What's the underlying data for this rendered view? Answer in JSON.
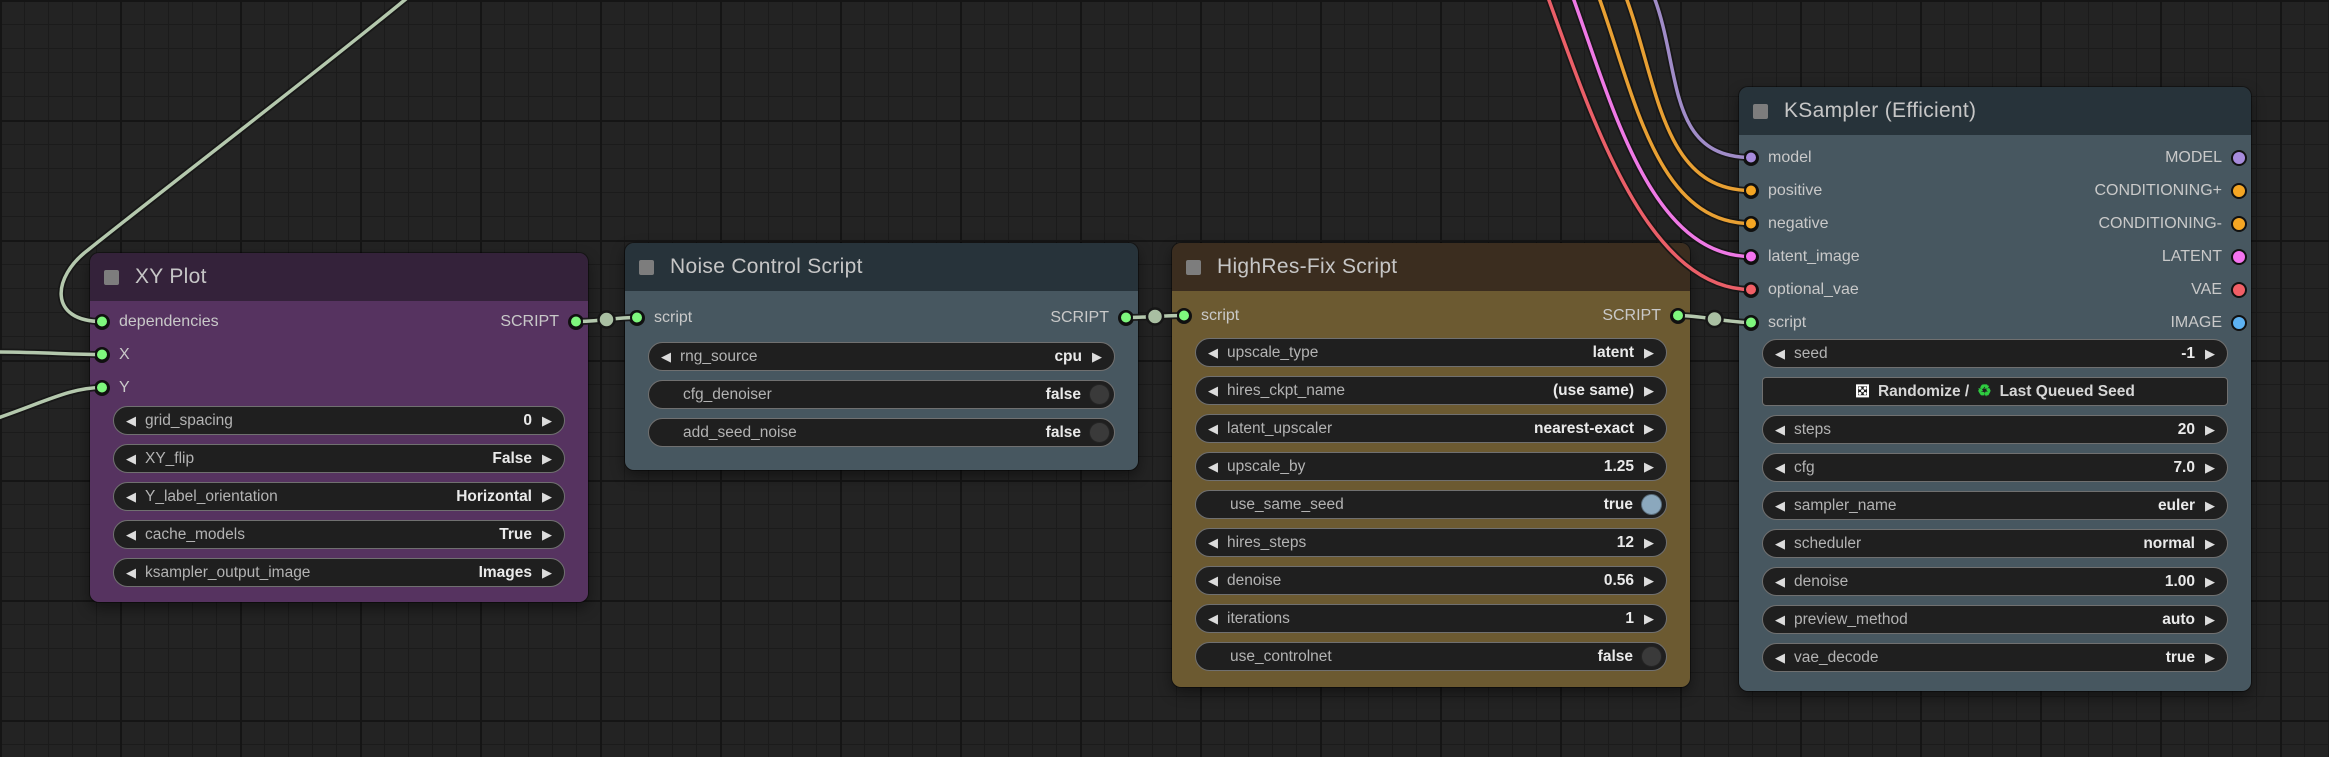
{
  "app": {
    "name": "node-graph-editor"
  },
  "palette": {
    "background": "#232323",
    "grid_minor": "#1b1b1b",
    "grid_major": "#151515",
    "link_dot": "#a9bfa2",
    "wire_green": "#b4c8ad",
    "wire_purple": "#a08cc8",
    "wire_orange": "#e8a033",
    "wire_pink": "#ef79e6",
    "wire_red": "#ea5f68",
    "toggle_on": "#8ba8bd",
    "toggle_off": "#3a3a3a",
    "widget_bg": "#1f1f1f",
    "widget_border": "#707070"
  },
  "glyphs": {
    "left_arrow": "◀",
    "right_arrow": "▶",
    "dice": "⚄",
    "recycle": "♻"
  },
  "nodes": [
    {
      "title": "XY Plot",
      "header_color": "#34223a",
      "body_color": "#563360",
      "inputs": [
        {
          "label": "dependencies",
          "color": "#7ef77d"
        },
        {
          "label": "X",
          "color": "#7ef77d"
        },
        {
          "label": "Y",
          "color": "#7ef77d"
        }
      ],
      "outputs": [
        {
          "label": "SCRIPT",
          "color": "#7ef77d"
        }
      ],
      "widgets": [
        {
          "type": "number",
          "label": "grid_spacing",
          "value": "0"
        },
        {
          "type": "combo",
          "label": "XY_flip",
          "value": "False"
        },
        {
          "type": "combo",
          "label": "Y_label_orientation",
          "value": "Horizontal"
        },
        {
          "type": "combo",
          "label": "cache_models",
          "value": "True"
        },
        {
          "type": "combo",
          "label": "ksampler_output_image",
          "value": "Images"
        }
      ]
    },
    {
      "title": "Noise Control Script",
      "header_color": "#27333a",
      "body_color": "#475760",
      "inputs": [
        {
          "label": "script",
          "color": "#7ef77d"
        }
      ],
      "outputs": [
        {
          "label": "SCRIPT",
          "color": "#7ef77d"
        }
      ],
      "widgets": [
        {
          "type": "combo",
          "label": "rng_source",
          "value": "cpu"
        },
        {
          "type": "toggle",
          "label": "cfg_denoiser",
          "value": "false"
        },
        {
          "type": "toggle",
          "label": "add_seed_noise",
          "value": "false"
        }
      ]
    },
    {
      "title": "HighRes-Fix Script",
      "header_color": "#3b2d1f",
      "body_color": "#6c5a31",
      "inputs": [
        {
          "label": "script",
          "color": "#7ef77d"
        }
      ],
      "outputs": [
        {
          "label": "SCRIPT",
          "color": "#7ef77d"
        }
      ],
      "widgets": [
        {
          "type": "combo",
          "label": "upscale_type",
          "value": "latent"
        },
        {
          "type": "combo",
          "label": "hires_ckpt_name",
          "value": "(use same)"
        },
        {
          "type": "combo",
          "label": "latent_upscaler",
          "value": "nearest-exact"
        },
        {
          "type": "number",
          "label": "upscale_by",
          "value": "1.25"
        },
        {
          "type": "toggle",
          "label": "use_same_seed",
          "value": "true"
        },
        {
          "type": "number",
          "label": "hires_steps",
          "value": "12"
        },
        {
          "type": "number",
          "label": "denoise",
          "value": "0.56"
        },
        {
          "type": "number",
          "label": "iterations",
          "value": "1"
        },
        {
          "type": "toggle",
          "label": "use_controlnet",
          "value": "false"
        }
      ]
    },
    {
      "title": "KSampler (Efficient)",
      "header_color": "#27333a",
      "body_color": "#475760",
      "inputs": [
        {
          "label": "model",
          "color": "#a78bdc"
        },
        {
          "label": "positive",
          "color": "#f5a623"
        },
        {
          "label": "negative",
          "color": "#f5a623"
        },
        {
          "label": "latent_image",
          "color": "#f573f0"
        },
        {
          "label": "optional_vae",
          "color": "#f25f66"
        },
        {
          "label": "script",
          "color": "#7ef77d"
        }
      ],
      "outputs": [
        {
          "label": "MODEL",
          "color": "#a78bdc"
        },
        {
          "label": "CONDITIONING+",
          "color": "#f5a623"
        },
        {
          "label": "CONDITIONING-",
          "color": "#f5a623"
        },
        {
          "label": "LATENT",
          "color": "#f573f0"
        },
        {
          "label": "VAE",
          "color": "#f25f66"
        },
        {
          "label": "IMAGE",
          "color": "#5db2f2"
        }
      ],
      "widgets": [
        {
          "type": "number",
          "label": "seed",
          "value": "-1"
        },
        {
          "type": "button",
          "label_left": "Randomize /",
          "label_right": "Last Queued Seed"
        },
        {
          "type": "number",
          "label": "steps",
          "value": "20"
        },
        {
          "type": "number",
          "label": "cfg",
          "value": "7.0"
        },
        {
          "type": "combo",
          "label": "sampler_name",
          "value": "euler"
        },
        {
          "type": "combo",
          "label": "scheduler",
          "value": "normal"
        },
        {
          "type": "number",
          "label": "denoise",
          "value": "1.00"
        },
        {
          "type": "combo",
          "label": "preview_method",
          "value": "auto"
        },
        {
          "type": "combo",
          "label": "vae_decode",
          "value": "true"
        }
      ]
    }
  ],
  "wires": [
    {
      "from": "offscreen-top",
      "to": "XY Plot.dependencies",
      "color": "#b4c8ad"
    },
    {
      "from": "offscreen-left",
      "to": "XY Plot.X",
      "color": "#b4c8ad"
    },
    {
      "from": "offscreen-left",
      "to": "XY Plot.Y",
      "color": "#b4c8ad"
    },
    {
      "from": "XY Plot.SCRIPT",
      "to": "Noise Control Script.script",
      "color": "#b4c8ad"
    },
    {
      "from": "Noise Control Script.SCRIPT",
      "to": "HighRes-Fix Script.script",
      "color": "#b4c8ad"
    },
    {
      "from": "HighRes-Fix Script.SCRIPT",
      "to": "KSampler (Efficient).script",
      "color": "#b4c8ad"
    },
    {
      "from": "offscreen-top",
      "to": "KSampler (Efficient).model",
      "color": "#a08cc8"
    },
    {
      "from": "offscreen-top",
      "to": "KSampler (Efficient).positive",
      "color": "#e8a033"
    },
    {
      "from": "offscreen-top",
      "to": "KSampler (Efficient).negative",
      "color": "#e8a033"
    },
    {
      "from": "offscreen-top",
      "to": "KSampler (Efficient).latent_image",
      "color": "#ef79e6"
    },
    {
      "from": "offscreen-top",
      "to": "KSampler (Efficient).optional_vae",
      "color": "#ea5f68"
    }
  ]
}
